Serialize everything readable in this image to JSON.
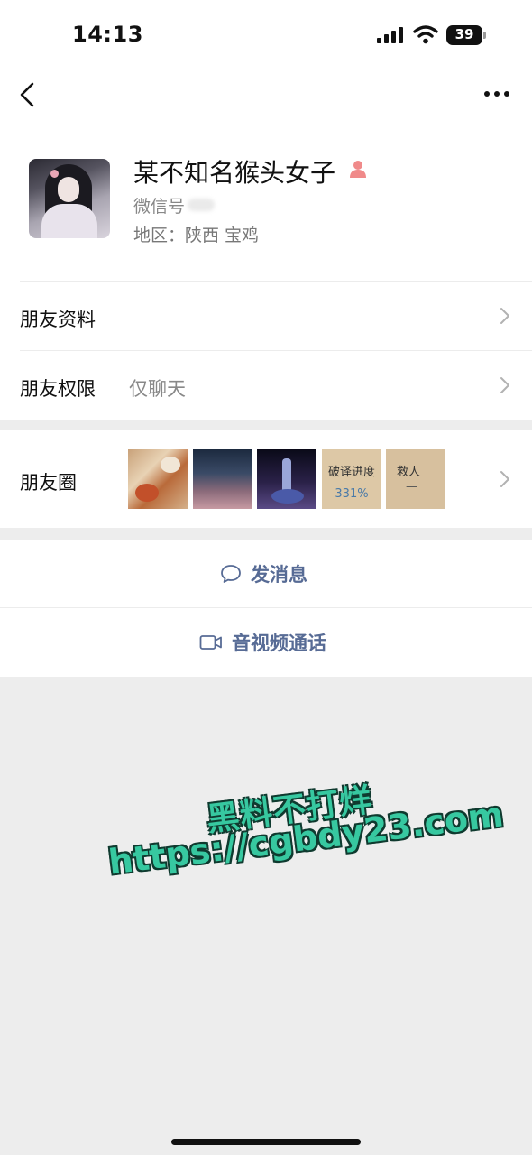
{
  "status_bar": {
    "time": "14:13",
    "battery": "39"
  },
  "nav": {
    "back_icon": "chevron-left-icon",
    "more_icon": "more-dots-icon"
  },
  "profile": {
    "nickname": "某不知名猴头女子",
    "wechat_id_label": "微信号",
    "region": "地区：陕西 宝鸡",
    "gender_icon": "person-icon",
    "gender_icon_color": "#f08a8a"
  },
  "rows": {
    "friend_info": {
      "label": "朋友资料"
    },
    "permissions": {
      "label": "朋友权限",
      "value": "仅聊天"
    },
    "moments": {
      "label": "朋友圈",
      "thumbnails": [
        {
          "name": "food-photo"
        },
        {
          "name": "sky-clouds-photo"
        },
        {
          "name": "night-figure-photo"
        },
        {
          "name": "text-card",
          "line1": "破译进度",
          "line2": "331%"
        },
        {
          "name": "text-card",
          "line1": "救人",
          "line2": "—"
        }
      ]
    }
  },
  "actions": {
    "message": {
      "label": "发消息",
      "icon": "chat-bubble-icon"
    },
    "video_call": {
      "label": "音视频通话",
      "icon": "video-camera-icon"
    }
  },
  "watermark": {
    "line1": "黑料不打烊",
    "line2": "https://cgbdy23.com"
  },
  "colors": {
    "link_blue": "#576b95",
    "background_gray": "#ededed",
    "watermark_green": "#37c8a0"
  }
}
